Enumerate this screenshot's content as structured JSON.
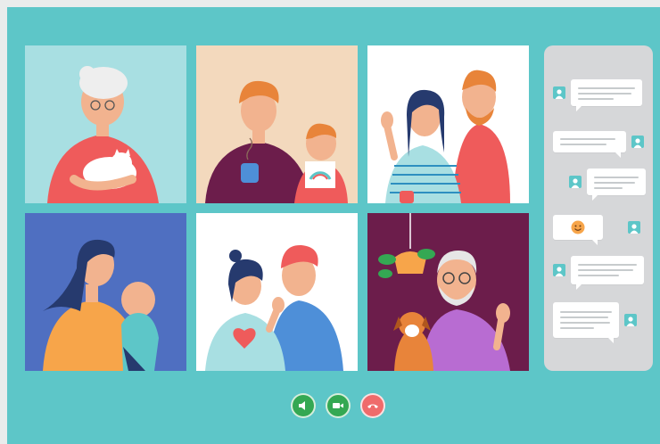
{
  "call": {
    "participants": [
      {
        "id": "grandmother",
        "background": "#a8dfe2"
      },
      {
        "id": "father-daughter",
        "background": "#f3d9bd"
      },
      {
        "id": "couple-waving",
        "background": "#ffffff"
      },
      {
        "id": "mother-baby",
        "background": "#4f6fc1"
      },
      {
        "id": "young-couple",
        "background": "#ffffff"
      },
      {
        "id": "grandfather-dog",
        "background": "#6c1d4b"
      }
    ],
    "controls": [
      {
        "id": "speaker",
        "icon": "speaker-icon",
        "color": "#34a853"
      },
      {
        "id": "camera",
        "icon": "video-camera-icon",
        "color": "#34a853"
      },
      {
        "id": "hang-up",
        "icon": "phone-hangup-icon",
        "color": "#ef6b6b"
      }
    ]
  },
  "chat": {
    "messages": [
      {
        "side": "left",
        "type": "text"
      },
      {
        "side": "right",
        "type": "text"
      },
      {
        "side": "left",
        "type": "text"
      },
      {
        "side": "right",
        "type": "emoji",
        "icon": "smiley-icon"
      },
      {
        "side": "left",
        "type": "text"
      },
      {
        "side": "right",
        "type": "text"
      }
    ]
  },
  "colors": {
    "app_background": "#5dc6c8",
    "chat_panel": "#d6d7d9",
    "accept": "#34a853",
    "decline": "#ef6b6b"
  }
}
